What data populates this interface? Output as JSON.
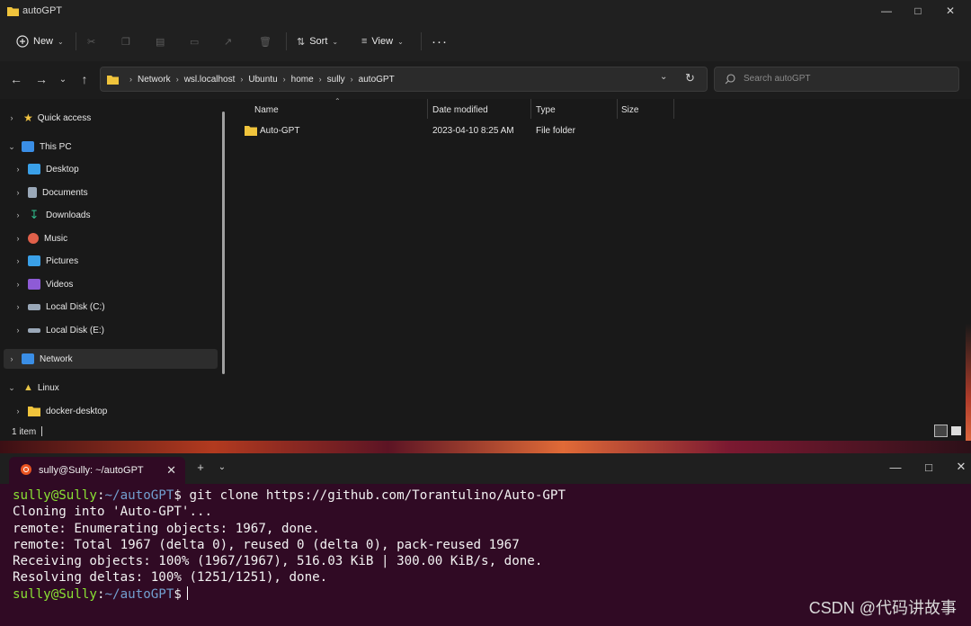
{
  "explorer": {
    "window_title": "autoGPT",
    "toolbar": {
      "new_label": "New",
      "sort_label": "Sort",
      "view_label": "View",
      "more_label": "···"
    },
    "breadcrumb": [
      "Network",
      "wsl.localhost",
      "Ubuntu",
      "home",
      "sully",
      "autoGPT"
    ],
    "search_placeholder": "Search autoGPT",
    "sidebar": {
      "items": [
        {
          "label": "Quick access",
          "icon": "star-icon",
          "color": "#f4c542"
        },
        {
          "label": "This PC",
          "icon": "monitor-icon",
          "color": "#3a8ee6"
        },
        {
          "label": "Desktop",
          "icon": "desktop-icon",
          "color": "#3aa0e8"
        },
        {
          "label": "Documents",
          "icon": "document-icon",
          "color": "#9aa8b8"
        },
        {
          "label": "Downloads",
          "icon": "download-icon",
          "color": "#2fb98a"
        },
        {
          "label": "Music",
          "icon": "music-icon",
          "color": "#e0604a"
        },
        {
          "label": "Pictures",
          "icon": "pictures-icon",
          "color": "#3aa0e8"
        },
        {
          "label": "Videos",
          "icon": "videos-icon",
          "color": "#8e5bd6"
        },
        {
          "label": "Local Disk (C:)",
          "icon": "drive-icon",
          "color": "#9aa8b8"
        },
        {
          "label": "Local Disk (E:)",
          "icon": "drive-icon",
          "color": "#9aa8b8"
        },
        {
          "label": "Network",
          "icon": "network-icon",
          "color": "#3a8ee6"
        },
        {
          "label": "Linux",
          "icon": "linux-icon",
          "color": "#e8c547"
        },
        {
          "label": "docker-desktop",
          "icon": "folder-icon",
          "color": "#f0c43c"
        }
      ]
    },
    "columns": {
      "name": "Name",
      "date": "Date modified",
      "type": "Type",
      "size": "Size"
    },
    "files": [
      {
        "name": "Auto-GPT",
        "date": "2023-04-10 8:25 AM",
        "type": "File folder",
        "size": ""
      }
    ],
    "status": "1 item"
  },
  "terminal": {
    "tab_title": "sully@Sully: ~/autoGPT",
    "prompt_user": "sully@Sully",
    "prompt_path": "~/autoGPT",
    "command": " git clone https://github.com/Torantulino/Auto-GPT",
    "output": [
      "Cloning into 'Auto-GPT'...",
      "remote: Enumerating objects: 1967, done.",
      "remote: Total 1967 (delta 0), reused 0 (delta 0), pack-reused 1967",
      "Receiving objects: 100% (1967/1967), 516.03 KiB | 300.00 KiB/s, done.",
      "Resolving deltas: 100% (1251/1251), done."
    ]
  },
  "watermark": "CSDN @代码讲故事"
}
